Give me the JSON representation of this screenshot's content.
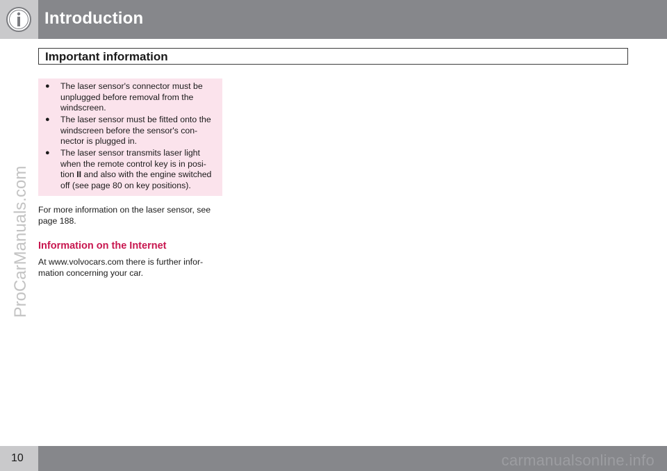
{
  "header": {
    "chapter_title": "Introduction",
    "icon": "info-icon"
  },
  "section": {
    "title": "Important information"
  },
  "note_box": {
    "background": "#fbe3ec",
    "items": [
      {
        "lines": [
          "The laser sensor's connector must be",
          "unplugged before removal from the",
          "windscreen."
        ]
      },
      {
        "lines": [
          "The laser sensor must be fitted onto the",
          "windscreen before the sensor's con-",
          "nector is plugged in."
        ]
      },
      {
        "lines": [
          "The laser sensor transmits laser light",
          "when the remote control key is in posi-",
          "tion ",
          "II",
          " and also with the engine switched",
          "off (see page 80 on key positions)."
        ]
      }
    ]
  },
  "body": {
    "para1_lines": [
      "For more information on the laser sensor, see",
      "page 188."
    ],
    "subheading": "Information on the Internet",
    "subheading_color": "#c8174f",
    "para2_lines": [
      "At  www.volvocars.com there is further infor-",
      "mation concerning your car."
    ]
  },
  "footer": {
    "page_number": "10"
  },
  "watermarks": {
    "left": "ProCarManuals.com",
    "bottom": "carmanualsonline.info"
  },
  "colors": {
    "header_bar": "#86878b",
    "header_tab": "#c9c9cb"
  }
}
